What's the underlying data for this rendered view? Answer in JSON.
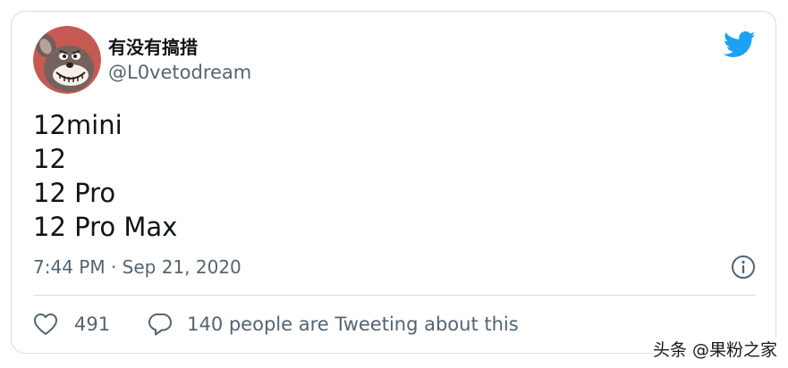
{
  "tweet": {
    "author": {
      "display_name": "有没有搞措",
      "handle": "@L0vetodream",
      "avatar_icon": "cartoon-mouse-avatar"
    },
    "text_lines": [
      "12mini",
      "12",
      "12 Pro",
      "12 Pro Max"
    ],
    "timestamp": "7:44 PM · Sep 21, 2020",
    "likes": "491",
    "reply_text": "140 people are Tweeting about this"
  },
  "icons": {
    "logo": "twitter-bird-icon",
    "info": "info-icon",
    "like": "heart-icon",
    "reply": "speech-bubble-icon"
  },
  "colors": {
    "brand": "#1da1f2",
    "text": "#0f1419",
    "secondary": "#536471",
    "border": "#d6dde3"
  },
  "watermark": "头条 @果粉之家"
}
